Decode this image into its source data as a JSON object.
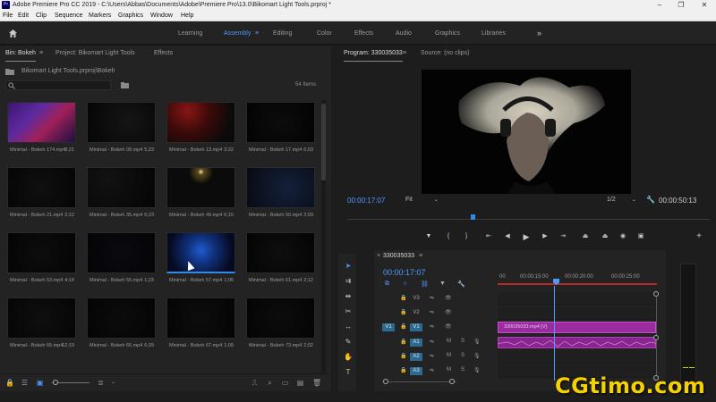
{
  "window": {
    "title": "Adobe Premiere Pro CC 2019 - C:\\Users\\Abbas\\Documents\\Adobe\\Premiere Pro\\13.0\\Bikomart Light Tools.prproj *",
    "app_icon": "Pr",
    "minimize": "–",
    "maximize": "❐",
    "close": "✕"
  },
  "menu": [
    "File",
    "Edit",
    "Clip",
    "Sequence",
    "Markers",
    "Graphics",
    "Window",
    "Help"
  ],
  "workspaces": {
    "items": [
      "Learning",
      "Assembly",
      "Editing",
      "Color",
      "Effects",
      "Audio",
      "Graphics",
      "Libraries"
    ],
    "active": "Assembly",
    "overflow": "»"
  },
  "project_panel": {
    "tabs": [
      "Bin: Bokeh",
      "Project: Bikomart Light Tools",
      "Effects"
    ],
    "active_tab": "Bin: Bokeh",
    "path": "Bikomart Light Tools.prproj\\Bokeh",
    "search_placeholder": "",
    "item_count": "54 Items",
    "clips": [
      {
        "name": "Minimal - Bokeh 174.mp4",
        "duration": "3;21"
      },
      {
        "name": "Minimal - Bokeh 09.mp4",
        "duration": "5;23"
      },
      {
        "name": "Minimal - Bokeh 13.mp4",
        "duration": "3;22"
      },
      {
        "name": "Minimal - Bokeh 17.mp4",
        "duration": "6;03"
      },
      {
        "name": "Minimal - Bokeh 21.mp4",
        "duration": "2;12"
      },
      {
        "name": "Minimal - Bokeh 35.mp4",
        "duration": "6;23"
      },
      {
        "name": "Minimal - Bokeh 49.mp4",
        "duration": "6;15"
      },
      {
        "name": "Minimal - Bokeh 50.mp4",
        "duration": "2;09"
      },
      {
        "name": "Minimal - Bokeh 53.mp4",
        "duration": "4;14"
      },
      {
        "name": "Minimal - Bokeh 55.mp4",
        "duration": "1;23"
      },
      {
        "name": "Minimal - Bokeh 57.mp4",
        "duration": "1;05"
      },
      {
        "name": "Minimal - Bokeh 61.mp4",
        "duration": "2;12"
      },
      {
        "name": "Minimal - Bokeh 65.mp4",
        "duration": "12;19"
      },
      {
        "name": "Minimal - Bokeh 66.mp4",
        "duration": "6;29"
      },
      {
        "name": "Minimal - Bokeh 67.mp4",
        "duration": "1;09"
      },
      {
        "name": "Minimal - Bokeh 73.mp4",
        "duration": "2;02"
      }
    ]
  },
  "program_monitor": {
    "tabs": [
      "Program: 330035033",
      "Source: (no clips)"
    ],
    "active_tab": "Program: 330035033",
    "current_timecode": "00:00:17:07",
    "duration_timecode": "00:00:50:13",
    "zoom": "Fit",
    "resolution": "1/2",
    "playhead_fraction": 0.34
  },
  "timeline": {
    "sequence_name": "330035033",
    "timecode": "00:00:17:07",
    "ruler_labels": [
      "00",
      "00:00:15:00",
      "00:00:20:00",
      "00:00:25:00"
    ],
    "video_tracks": [
      "V3",
      "V2",
      "V1"
    ],
    "audio_tracks": [
      "A1",
      "A2",
      "A3"
    ],
    "source_patch_video": "V1",
    "video_clip_label": "330035033.mp4 [V]",
    "track_toggles": {
      "mute": "M",
      "solo": "S"
    }
  },
  "audio_meter": {
    "labels": [
      "-12",
      "-24",
      "-36",
      "-48",
      "dB"
    ]
  },
  "watermark": "CGtimo.com",
  "colors": {
    "accent": "#4e9bff",
    "clip_video": "#9b2ca0",
    "clip_audio": "#8a2590",
    "work_area": "#b52a2a"
  }
}
